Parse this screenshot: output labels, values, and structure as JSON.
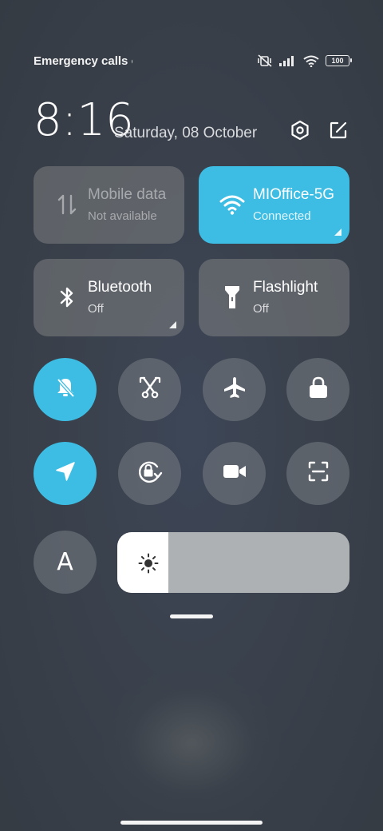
{
  "status": {
    "carrier_text": "Emergency calls only",
    "battery": "100",
    "icons": [
      "mute-vibrate-icon",
      "signal-icon",
      "wifi-icon",
      "battery-icon"
    ]
  },
  "header": {
    "time": "8:16",
    "date": "Saturday, 08 October",
    "icons": [
      "settings-icon",
      "edit-icon"
    ]
  },
  "tiles": [
    {
      "name": "Mobile data",
      "status": "Not available",
      "state": "disabled",
      "icon": "data-arrows-icon"
    },
    {
      "name": "MIOffice-5G",
      "status": "Connected",
      "state": "active",
      "icon": "wifi-icon"
    },
    {
      "name": "Bluetooth",
      "status": "Off",
      "state": "off",
      "icon": "bluetooth-icon"
    },
    {
      "name": "Flashlight",
      "status": "Off",
      "state": "off",
      "icon": "flashlight-icon"
    }
  ],
  "toggles": [
    {
      "id": "mute",
      "icon": "bell-off-icon",
      "state": "on"
    },
    {
      "id": "screenshot",
      "icon": "scissors-icon",
      "state": "off"
    },
    {
      "id": "airplane",
      "icon": "airplane-icon",
      "state": "off"
    },
    {
      "id": "lock",
      "icon": "lock-icon",
      "state": "off"
    },
    {
      "id": "location",
      "icon": "location-arrow-icon",
      "state": "on"
    },
    {
      "id": "auto-rotate",
      "icon": "rotation-lock-icon",
      "state": "off"
    },
    {
      "id": "screen-recorder",
      "icon": "video-camera-icon",
      "state": "off"
    },
    {
      "id": "scanner",
      "icon": "scan-icon",
      "state": "off"
    }
  ],
  "font_size_button": "A",
  "brightness": {
    "level": 0.22,
    "icon": "sun-icon"
  },
  "colors": {
    "accent": "#3dbde3",
    "tile_bg": "#6b6f73",
    "round_bg": "#5e646c",
    "brightness_track": "#aeb1b4"
  }
}
